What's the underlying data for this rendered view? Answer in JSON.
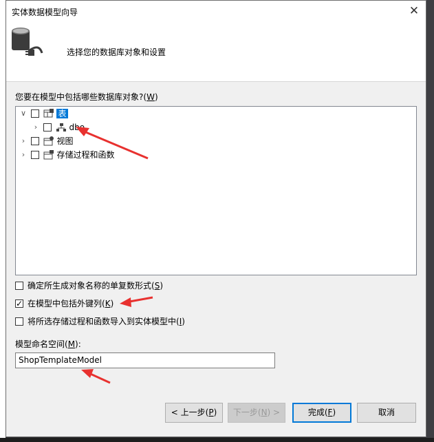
{
  "window": {
    "title": "实体数据模型向导",
    "close_icon": "close-icon"
  },
  "header": {
    "text": "选择您的数据库对象和设置"
  },
  "tree": {
    "label": "您要在模型中包括哪些数据库对象?(",
    "label_key": "W",
    "label_end": ")",
    "nodes": [
      {
        "label": "表",
        "expanded": true,
        "selected": true
      },
      {
        "label": "dbo",
        "expanded": false
      },
      {
        "label": "视图",
        "expanded": false
      },
      {
        "label": "存储过程和函数",
        "expanded": false
      }
    ]
  },
  "options": [
    {
      "label": "确定所生成对象名称的单复数形式(",
      "key": "S",
      "end": ")",
      "checked": false
    },
    {
      "label": "在模型中包括外键列(",
      "key": "K",
      "end": ")",
      "checked": true
    },
    {
      "label": "将所选存储过程和函数导入到实体模型中(",
      "key": "I",
      "end": ")",
      "checked": false
    }
  ],
  "namespace": {
    "label": "模型命名空间(",
    "label_key": "M",
    "label_end": "):",
    "value": "ShopTemplateModel"
  },
  "buttons": {
    "prev": "< 上一步(",
    "prev_key": "P",
    "prev_end": ")",
    "next": "下一步(",
    "next_key": "N",
    "next_end": ") >",
    "finish": "完成(",
    "finish_key": "F",
    "finish_end": ")",
    "cancel": "取消"
  },
  "colors": {
    "selection": "#0078d7",
    "annotation_arrow": "#e8312f"
  }
}
